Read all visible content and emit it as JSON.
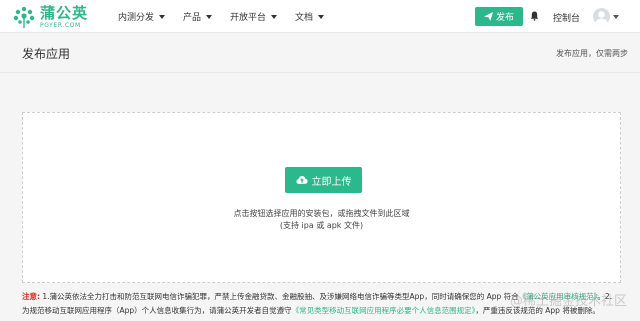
{
  "brand": {
    "name_cn": "蒲公英",
    "name_en": "PGYER.COM",
    "color": "#2bb88a"
  },
  "nav": {
    "items": [
      {
        "label": "内测分发"
      },
      {
        "label": "产品"
      },
      {
        "label": "开放平台"
      },
      {
        "label": "文档"
      }
    ]
  },
  "header": {
    "publish_label": "发布",
    "console_label": "控制台",
    "bell_icon": "bell-icon",
    "avatar_icon": "user-avatar"
  },
  "page": {
    "title": "发布应用",
    "breadcrumb": "发布应用，仅需两步"
  },
  "upload": {
    "button_label": "立即上传",
    "hint_line1": "点击按钮选择应用的安装包，或拖拽文件到此区域",
    "hint_line2": "(支持 ipa 或 apk 文件)"
  },
  "notice": {
    "label": "注意:",
    "line1_text": "1.蒲公英依法全力打击和防范互联网电信诈骗犯罪，严禁上传金融贷款、金融股抽、及涉嫌网络电信诈骗等类型App，同时请确保您的 App 符合",
    "line1_link": "《蒲公英应用审核规范》",
    "line1_tail": "。2.",
    "line2_text": "为规范移动互联网应用程序（App）个人信息收集行为，请蒲公英开发者自觉遵守",
    "line2_link": "《常见类型移动互联网应用程序必要个人信息范围规定》",
    "line2_tail": "，严重违反该规范的 App 将被删除。"
  },
  "watermark": "@稀土掘金技术社区"
}
